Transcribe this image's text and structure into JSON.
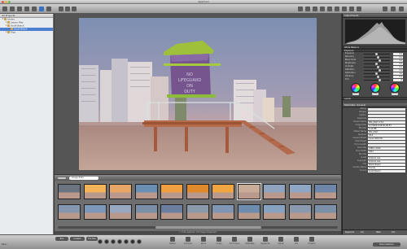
{
  "window": {
    "title": "Aperture"
  },
  "projects_panel": {
    "header": "All Projects",
    "items": [
      {
        "label": "Library",
        "indent": 0,
        "selected": false
      },
      {
        "label": "Lesson Files",
        "indent": 1,
        "selected": false
      },
      {
        "label": "South Beach",
        "indent": 1,
        "selected": false
      },
      {
        "label": "South Beach",
        "indent": 2,
        "selected": true
      },
      {
        "label": "Trips",
        "indent": 1,
        "selected": false
      }
    ]
  },
  "filmstrip": {
    "search_placeholder": "Image Edits",
    "status": "1 of 24 selected, 24 Images Displayed",
    "thumbs_row1": [
      "#6b7480",
      "#f5b45a",
      "#e7a566",
      "#6a8fb4",
      "#f0a040",
      "#e08a2c",
      "#f0a640",
      "#c9ad99",
      "#8ea4c0",
      "#8fa6c4",
      "#6e86aa"
    ],
    "thumbs_row2": [
      "#8597b0",
      "#7d97b8",
      "#98a8c0",
      "#7b8ea8",
      "#6c7ea0",
      "#8a9aaa",
      "#7f95b2",
      "#6d8cae",
      "#86a2c0",
      "#8a99ae",
      "#7c8fa8"
    ],
    "selected_index": 7
  },
  "bottom_toolbar": {
    "tools": [
      "Rotate",
      "Compare",
      "Stack",
      "Loupe",
      "Full Screen",
      "Metadata",
      "Keywords",
      "Adjust",
      "Info",
      "Projects"
    ],
    "left_text": "Basic",
    "buttons": [
      "Pick",
      "Unstack",
      "Full Size",
      "Share Selection"
    ]
  },
  "inspector": {
    "adjustments_header": "Adjustments",
    "white_balance_label": "White Balance",
    "exposure_label": "Exposure",
    "adjustments": [
      {
        "label": "Exposure",
        "value": "0.0"
      },
      {
        "label": "Recovery",
        "value": "0.0"
      },
      {
        "label": "Black Point",
        "value": "5.0"
      },
      {
        "label": "Brightness",
        "value": "0.0"
      },
      {
        "label": "Contrast",
        "value": "0.0"
      },
      {
        "label": "Definition",
        "value": "0.0"
      },
      {
        "label": "Saturation",
        "value": "1.0"
      },
      {
        "label": "Vibrancy",
        "value": "0.0"
      },
      {
        "label": "Tint",
        "value": "0"
      }
    ],
    "wheel_labels": [
      "Black",
      "Gray",
      "White"
    ],
    "levels_label": "Levels",
    "metadata_header": "Metadata: General",
    "metadata": [
      {
        "key": "Rating",
        "value": ""
      },
      {
        "key": "Badges",
        "value": ""
      },
      {
        "key": "Caption",
        "value": ""
      },
      {
        "key": "Keywords",
        "value": ""
      },
      {
        "key": "Version Name",
        "value": "IMG_0367 of 16"
      },
      {
        "key": "Image Date",
        "value": "2/7/2009 6:58:00 AM ET"
      },
      {
        "key": "File Size",
        "value": "6.16 MB"
      },
      {
        "key": "Master Name",
        "value": "IMG_0367"
      },
      {
        "key": "Aperture",
        "value": "f/8.0"
      },
      {
        "key": "Camera Model",
        "value": "Canon EOS 5D"
      },
      {
        "key": "Pixel Height",
        "value": ""
      },
      {
        "key": "Focal Length",
        "value": ""
      },
      {
        "key": "Pixel Size",
        "value": "4368 x 2912"
      },
      {
        "key": "Pixel Width",
        "value": "2912"
      },
      {
        "key": "File Size",
        "value": ""
      },
      {
        "key": "Credit",
        "value": "Orlando Luis"
      },
      {
        "key": "Copyright",
        "value": "Orlando Luis"
      },
      {
        "key": "City",
        "value": "Miami Beach"
      },
      {
        "key": "Country Name",
        "value": "Florida"
      },
      {
        "key": "Source",
        "value": "South Beach"
      }
    ],
    "bottom_tabs": [
      "Keywords",
      "Adj",
      "Meta",
      "Info"
    ]
  }
}
